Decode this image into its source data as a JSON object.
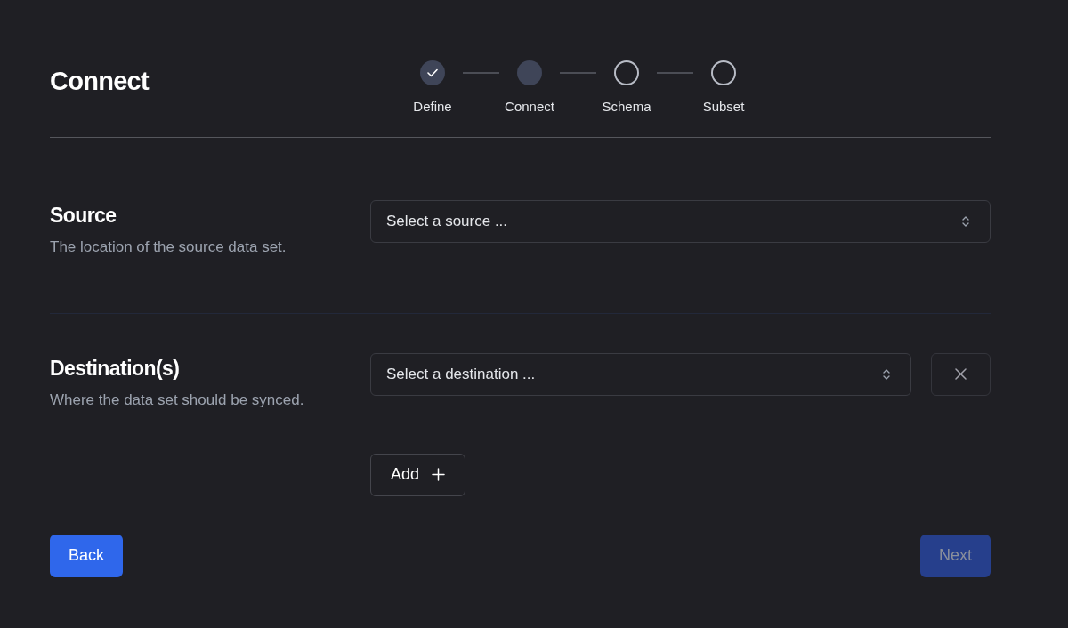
{
  "page_title": "Connect",
  "steps": [
    {
      "label": "Define",
      "kind": "complete"
    },
    {
      "label": "Connect",
      "kind": "current"
    },
    {
      "label": "Schema",
      "kind": "upcoming"
    },
    {
      "label": "Subset",
      "kind": "upcoming"
    }
  ],
  "source": {
    "title": "Source",
    "description": "The location of the source data set.",
    "select": {
      "placeholder": "Select a source ..."
    }
  },
  "destinations": {
    "title": "Destination(s)",
    "description": "Where the data set should be synced.",
    "selects": [
      {
        "placeholder": "Select a destination ..."
      }
    ],
    "add_button": "Add"
  },
  "footer": {
    "back": {
      "label": "Back",
      "disabled": false
    },
    "next": {
      "label": "Next",
      "disabled": true
    }
  }
}
